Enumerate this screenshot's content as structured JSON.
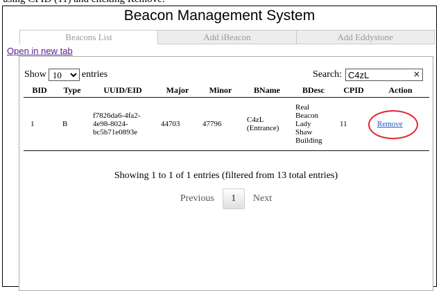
{
  "app_title": "Beacon Management System",
  "top_partial_text": "using CPID (11) and clicking Remove:",
  "tabs": [
    {
      "label": "Beacons List",
      "active": true
    },
    {
      "label": "Add iBeacon",
      "active": false
    },
    {
      "label": "Add Eddystone",
      "active": false
    }
  ],
  "open_link": "Open in new tab",
  "length": {
    "show_label": "Show",
    "value": "10",
    "entries_label": "entries"
  },
  "search": {
    "label": "Search:",
    "value": "C4zL",
    "clear_icon": "×"
  },
  "table": {
    "headers": [
      "BID",
      "Type",
      "UUID/EID",
      "Major",
      "Minor",
      "BName",
      "BDesc",
      "CPID",
      "Action"
    ],
    "rows": [
      {
        "bid": "1",
        "type": "B",
        "uuid_lines": [
          "f7826da6-4fa2-",
          "4e98-8024-",
          "bc5b71e0893e"
        ],
        "major": "44703",
        "minor": "47796",
        "bname_lines": [
          "C4zL",
          "(Entrance)"
        ],
        "bdesc_lines": [
          "Real",
          "Beacon",
          "Lady",
          "Shaw",
          "Building"
        ],
        "cpid": "11",
        "action": "Remove"
      }
    ]
  },
  "info": "Showing 1 to 1 of 1 entries (filtered from 13 total entries)",
  "pager": {
    "previous": "Previous",
    "current": "1",
    "next": "Next"
  },
  "colors": {
    "highlight_circle": "#e0262f",
    "link": "#1a55c9",
    "visited_link": "#551a8b"
  }
}
